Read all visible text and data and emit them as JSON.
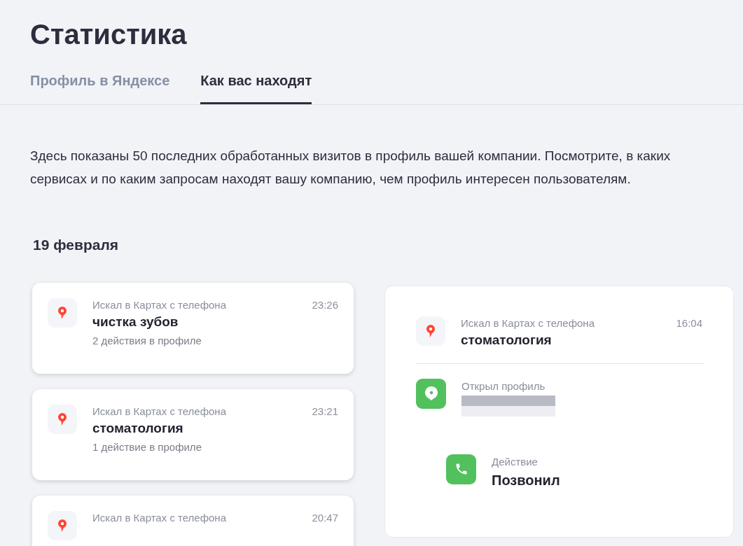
{
  "title": "Статистика",
  "tabs": [
    {
      "label": "Профиль в Яндексе",
      "selected": false
    },
    {
      "label": "Как вас находят",
      "selected": true
    }
  ],
  "description": "Здесь показаны 50 последних обработанных визитов в профиль вашей компании. Посмотрите, в каких сервисах и по каким запросам находят вашу компанию, чем профиль интересен пользователям.",
  "date": "19 февраля",
  "visits": [
    {
      "source": "Искал в Картах с телефона",
      "query": "чистка зубов",
      "time": "23:26",
      "actions": "2 действия в профиле"
    },
    {
      "source": "Искал в Картах с телефона",
      "query": "стоматология",
      "time": "23:21",
      "actions": "1 действие в профиле"
    },
    {
      "source": "Искал в Картах с телефона",
      "time": "20:47"
    }
  ],
  "detail": {
    "source": "Искал в Картах с телефона",
    "query": "стоматология",
    "time": "16:04",
    "steps": [
      {
        "kind": "profile",
        "label": "Открыл профиль"
      },
      {
        "kind": "call",
        "label": "Действие",
        "value": "Позвонил"
      }
    ]
  }
}
